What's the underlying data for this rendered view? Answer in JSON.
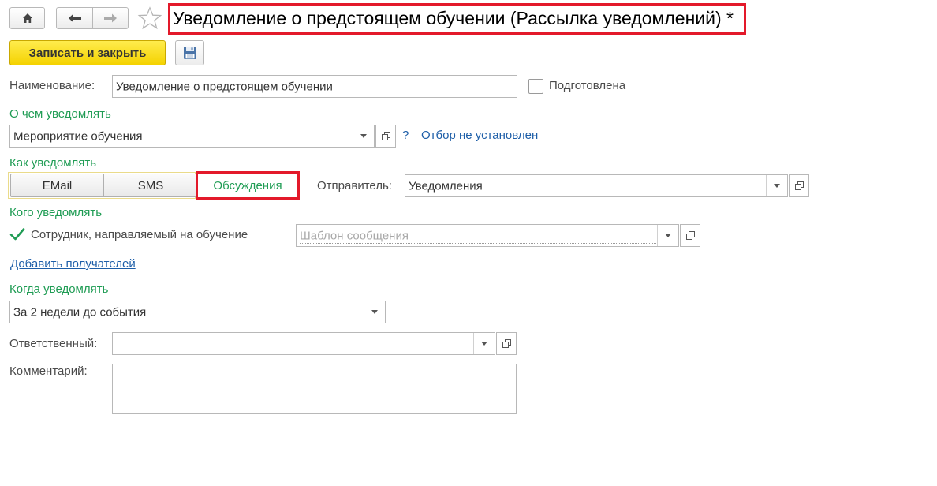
{
  "window": {
    "title": "Уведомление о предстоящем обучении (Рассылка уведомлений) *"
  },
  "nav": {
    "home_icon": "home-icon",
    "back_icon": "arrow-left-icon",
    "forward_icon": "arrow-right-icon",
    "favorite_icon": "star-icon"
  },
  "toolbar": {
    "save_close_label": "Записать и закрыть",
    "save_icon": "floppy-disk-icon"
  },
  "form": {
    "name_label": "Наименование:",
    "name_value": "Уведомление о предстоящем обучении",
    "prepared_label": "Подготовлена",
    "prepared_checked": false,
    "what_section": "О чем уведомлять",
    "what_value": "Мероприятие обучения",
    "help_mark": "?",
    "filter_link": "Отбор не установлен",
    "how_section": "Как уведомлять",
    "channels": [
      "EMail",
      "SMS",
      "Обсуждения"
    ],
    "selected_channel": "Обсуждения",
    "sender_label": "Отправитель:",
    "sender_value": "Уведомления",
    "whom_section": "Кого уведомлять",
    "employee_label": "Сотрудник, направляемый на обучение",
    "employee_checked": true,
    "template_placeholder": "Шаблон сообщения",
    "add_recipients_link": "Добавить получателей",
    "when_section": "Когда уведомлять",
    "when_value": "За 2 недели до события",
    "responsible_label": "Ответственный:",
    "responsible_value": "",
    "comment_label": "Комментарий:",
    "comment_value": ""
  },
  "colors": {
    "highlight": "#e3192a",
    "section": "#1f9c54",
    "link": "#1d5ea8",
    "primary_button": "#f4d200"
  }
}
